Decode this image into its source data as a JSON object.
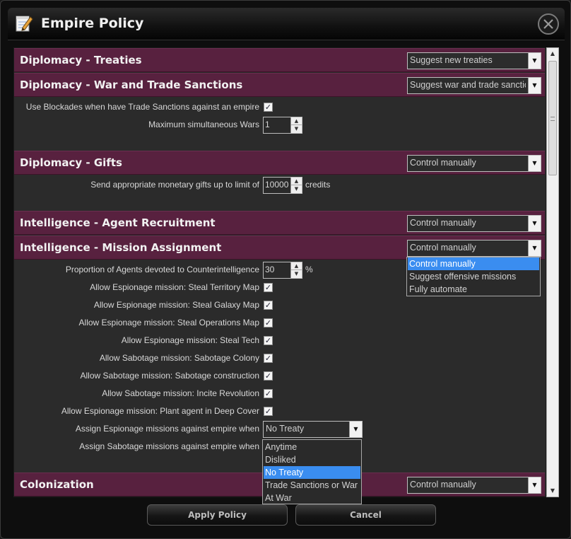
{
  "window": {
    "title": "Empire Policy",
    "icon": "notepad-pencil-icon",
    "close_icon": "close-icon"
  },
  "sections": [
    {
      "title": "Diplomacy - Treaties",
      "select": "Suggest new treaties"
    },
    {
      "title": "Diplomacy - War and Trade Sanctions",
      "select": "Suggest war and trade sanctions"
    },
    {
      "title": "Diplomacy - Gifts",
      "select": "Control manually"
    },
    {
      "title": "Intelligence - Agent Recruitment",
      "select": "Control manually"
    },
    {
      "title": "Intelligence - Mission Assignment",
      "select": "Control manually"
    },
    {
      "title": "Colonization",
      "select": "Control manually"
    }
  ],
  "war": {
    "blockades_label": "Use Blockades when have Trade Sanctions against an empire",
    "blockades_checked": true,
    "max_wars_label": "Maximum simultaneous Wars",
    "max_wars_value": "1"
  },
  "gifts": {
    "label": "Send appropriate monetary gifts up to limit of",
    "value": "10000",
    "suffix": "credits"
  },
  "missions": {
    "counter_label": "Proportion of Agents devoted to Counterintelligence",
    "counter_value": "30",
    "counter_suffix": "%",
    "checks": [
      {
        "label": "Allow Espionage mission: Steal Territory Map",
        "checked": true
      },
      {
        "label": "Allow Espionage mission: Steal Galaxy Map",
        "checked": true
      },
      {
        "label": "Allow Espionage mission: Steal Operations Map",
        "checked": true
      },
      {
        "label": "Allow Espionage mission: Steal Tech",
        "checked": true
      },
      {
        "label": "Allow Sabotage mission: Sabotage Colony",
        "checked": true
      },
      {
        "label": "Allow Sabotage mission: Sabotage construction",
        "checked": true
      },
      {
        "label": "Allow Sabotage mission: Incite Revolution",
        "checked": true
      },
      {
        "label": "Allow Espionage mission: Plant agent in Deep Cover",
        "checked": true
      }
    ],
    "espionage_when_label": "Assign Espionage missions against empire when",
    "espionage_when_value": "No Treaty",
    "sabotage_when_label": "Assign Sabotage missions against empire when"
  },
  "mission_dropdown": {
    "options": [
      "Control manually",
      "Suggest offensive missions",
      "Fully automate"
    ],
    "selected": "Control manually"
  },
  "when_dropdown": {
    "options": [
      "Anytime",
      "Disliked",
      "No Treaty",
      "Trade Sanctions or War",
      "At War"
    ],
    "selected": "No Treaty"
  },
  "footer": {
    "apply_label": "Apply Policy",
    "cancel_label": "Cancel"
  },
  "colors": {
    "section_header": "#58213f",
    "content_bg": "#2b2b2b",
    "highlight": "#3a8df0"
  }
}
